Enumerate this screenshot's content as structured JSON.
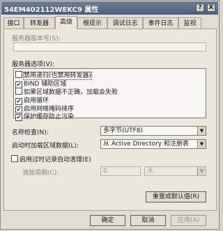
{
  "window": {
    "title": "54EM402112WEKC9 属性",
    "help_label": "?",
    "close_label": "X"
  },
  "tabs": [
    {
      "label": "接口"
    },
    {
      "label": "转发器"
    },
    {
      "label": "高级",
      "active": true
    },
    {
      "label": "根提示"
    },
    {
      "label": "调试日志"
    },
    {
      "label": "事件日志"
    },
    {
      "label": "监视"
    }
  ],
  "advanced": {
    "version_label": "服务器版本号(S):",
    "version_value": "",
    "options_label": "服务器选项(V):",
    "options": [
      {
        "label": "禁用递归(也禁用转发器)",
        "checked": false,
        "selected": true
      },
      {
        "label": "BIND 辅助区域",
        "checked": true
      },
      {
        "label": "如果区域数据不正确，加载会失败",
        "checked": false
      },
      {
        "label": "启用循环",
        "checked": true
      },
      {
        "label": "启用网络掩码排序",
        "checked": true
      },
      {
        "label": "保护缓存防止污染",
        "checked": true
      }
    ],
    "name_check_label": "名称检查(N):",
    "name_check_value": "多字节(UTF8)",
    "load_zone_label": "启动时加载区域数据(L):",
    "load_zone_value": "从 Active Directory 和注册表",
    "scavenging_label": "启用过时记录自动清理(E)",
    "scavenging_checked": false,
    "scavenging_period_label": "清除周期(C):",
    "scavenging_period_value": "0",
    "scavenging_unit": "天",
    "reset_button": "重置成默认值(R)"
  },
  "footer": {
    "ok": "确定",
    "cancel": "取消",
    "apply": "应用(A)"
  }
}
